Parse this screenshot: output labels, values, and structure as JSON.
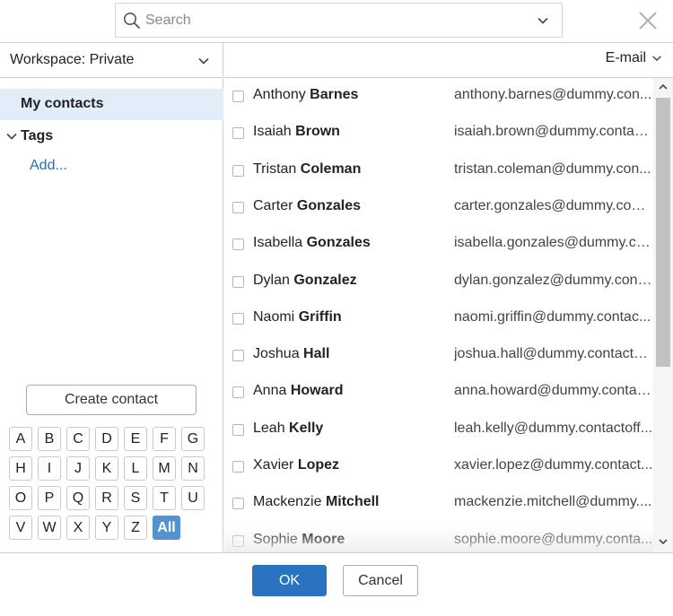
{
  "search": {
    "placeholder": "Search",
    "value": ""
  },
  "icons": {
    "search": "search-icon",
    "dropdown": "chevron-down-icon",
    "close": "close-icon",
    "scroll_up": "chevron-up-icon",
    "scroll_down": "chevron-down-icon"
  },
  "sidebar": {
    "workspace_label": "Workspace: Private",
    "my_contacts": "My contacts",
    "tags_label": "Tags",
    "add_label": "Add...",
    "create_contact": "Create contact",
    "alphabet": [
      "A",
      "B",
      "C",
      "D",
      "E",
      "F",
      "G",
      "H",
      "I",
      "J",
      "K",
      "L",
      "M",
      "N",
      "O",
      "P",
      "Q",
      "R",
      "S",
      "T",
      "U",
      "V",
      "W",
      "X",
      "Y",
      "Z",
      "All"
    ],
    "alphabet_selected": "All"
  },
  "list": {
    "field_label": "E-mail",
    "contacts": [
      {
        "first": "Anthony",
        "last": "Barnes",
        "email": "anthony.barnes@dummy.con..."
      },
      {
        "first": "Isaiah",
        "last": "Brown",
        "email": "isaiah.brown@dummy.contac..."
      },
      {
        "first": "Tristan",
        "last": "Coleman",
        "email": "tristan.coleman@dummy.con..."
      },
      {
        "first": "Carter",
        "last": "Gonzales",
        "email": "carter.gonzales@dummy.cont..."
      },
      {
        "first": "Isabella",
        "last": "Gonzales",
        "email": "isabella.gonzales@dummy.co..."
      },
      {
        "first": "Dylan",
        "last": "Gonzalez",
        "email": "dylan.gonzalez@dummy.cont..."
      },
      {
        "first": "Naomi",
        "last": "Griffin",
        "email": "naomi.griffin@dummy.contac..."
      },
      {
        "first": "Joshua",
        "last": "Hall",
        "email": "joshua.hall@dummy.contacto..."
      },
      {
        "first": "Anna",
        "last": "Howard",
        "email": "anna.howard@dummy.contac..."
      },
      {
        "first": "Leah",
        "last": "Kelly",
        "email": "leah.kelly@dummy.contactoff..."
      },
      {
        "first": "Xavier",
        "last": "Lopez",
        "email": "xavier.lopez@dummy.contact..."
      },
      {
        "first": "Mackenzie",
        "last": "Mitchell",
        "email": "mackenzie.mitchell@dummy...."
      },
      {
        "first": "Sophie",
        "last": "Moore",
        "email": "sophie.moore@dummy.conta..."
      }
    ]
  },
  "footer": {
    "ok": "OK",
    "cancel": "Cancel"
  },
  "colors": {
    "accent": "#2a73c0",
    "selected_bg": "#e1eef9",
    "alpha_active": "#5194cf",
    "link": "#2a6db0"
  }
}
